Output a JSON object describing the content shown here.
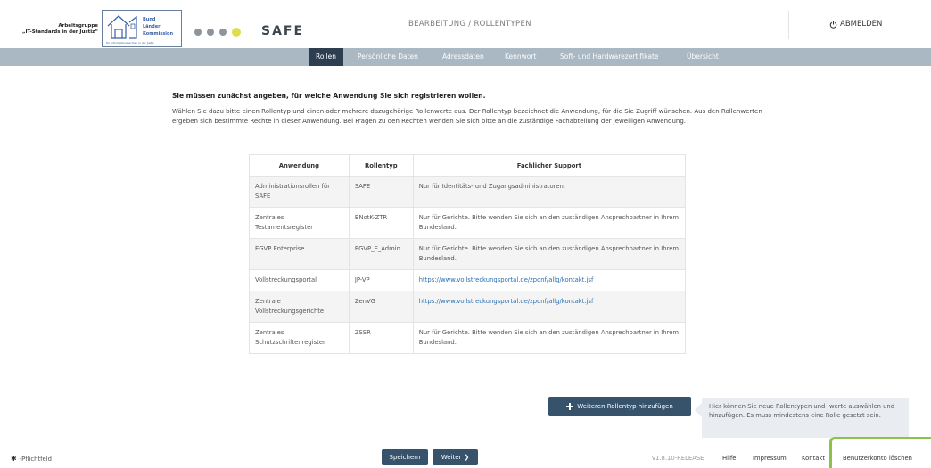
{
  "header": {
    "org_line1": "Arbeitsgruppe",
    "org_line2": "„IT-Standards in der Justiz“",
    "logo_text": [
      "Bund",
      "Länder",
      "Kommission"
    ],
    "logo_sub": "für Informationstechnik in der Justiz",
    "app_name": "SAFE",
    "breadcrumb": "BEARBEITUNG / ROLLENTYPEN",
    "logout_label": "ABMELDEN"
  },
  "nav": {
    "tabs": [
      {
        "label": "Rollen",
        "active": true
      },
      {
        "label": "Persönliche Daten",
        "active": false
      },
      {
        "label": "Adressdaten",
        "active": false
      },
      {
        "label": "Kennwort",
        "active": false
      },
      {
        "label": "Soft- und Hardwarezertifikate",
        "active": false
      },
      {
        "label": "Übersicht",
        "active": false
      }
    ]
  },
  "main": {
    "heading": "Sie müssen zunächst angeben, für welche Anwendung Sie sich registrieren wollen.",
    "intro": "Wählen Sie dazu bitte einen Rollentyp und einen oder mehrere dazugehörige Rollenwerte aus. Der Rollentyp bezeichnet die Anwendung, für die Sie Zugriff wünschen. Aus den Rollenwerten ergeben sich bestimmte Rechte in dieser Anwendung. Bei Fragen zu den Rechten wenden Sie sich bitte an die zuständige Fachabteilung der jeweiligen Anwendung.",
    "table": {
      "columns": [
        "Anwendung",
        "Rollentyp",
        "Fachlicher Support"
      ],
      "rows": [
        {
          "app": "Administrationsrollen für SAFE",
          "type": "SAFE",
          "support": "Nur für Identitäts- und Zugangsadministratoren.",
          "link": false
        },
        {
          "app": "Zentrales Testamentsregister",
          "type": "BNotK-ZTR",
          "support": "Nur für Gerichte. Bitte wenden Sie sich an den zuständigen Ansprechpartner in Ihrem Bundesland.",
          "link": false
        },
        {
          "app": "EGVP Enterprise",
          "type": "EGVP_E_Admin",
          "support": "Nur für Gerichte. Bitte wenden Sie sich an den zuständigen Ansprechpartner in Ihrem Bundesland.",
          "link": false
        },
        {
          "app": "Vollstreckungsportal",
          "type": "JP-VP",
          "support": "https://www.vollstreckungsportal.de/zponf/allg/kontakt.jsf",
          "link": true
        },
        {
          "app": "Zentrale Vollstreckungsgerichte",
          "type": "ZenVG",
          "support": "https://www.vollstreckungsportal.de/zponf/allg/kontakt.jsf",
          "link": true
        },
        {
          "app": "Zentrales Schutzschriftenregister",
          "type": "ZSSR",
          "support": "Nur für Gerichte. Bitte wenden Sie sich an den zuständigen Ansprechpartner in Ihrem Bundesland.",
          "link": false
        }
      ]
    },
    "add_button_label": "Weiteren Rollentyp hinzufügen",
    "tip": "Hier können Sie neue Rollentypen und -werte auswählen und hinzufügen. Es muss mindestens eine Rolle gesetzt sein."
  },
  "footer": {
    "required_label": "-Pflichtfeld",
    "save_label": "Speichern",
    "next_label": "Weiter",
    "version": "v1.8.10-RELEASE",
    "links": [
      "Hilfe",
      "Impressum",
      "Kontakt",
      "Benutzerkonto löschen"
    ]
  },
  "colors": {
    "nav_bg": "#aab8c3",
    "nav_active": "#2c3e50",
    "button": "#37536c",
    "link": "#2a6fb0",
    "highlight": "#8bc34a"
  }
}
